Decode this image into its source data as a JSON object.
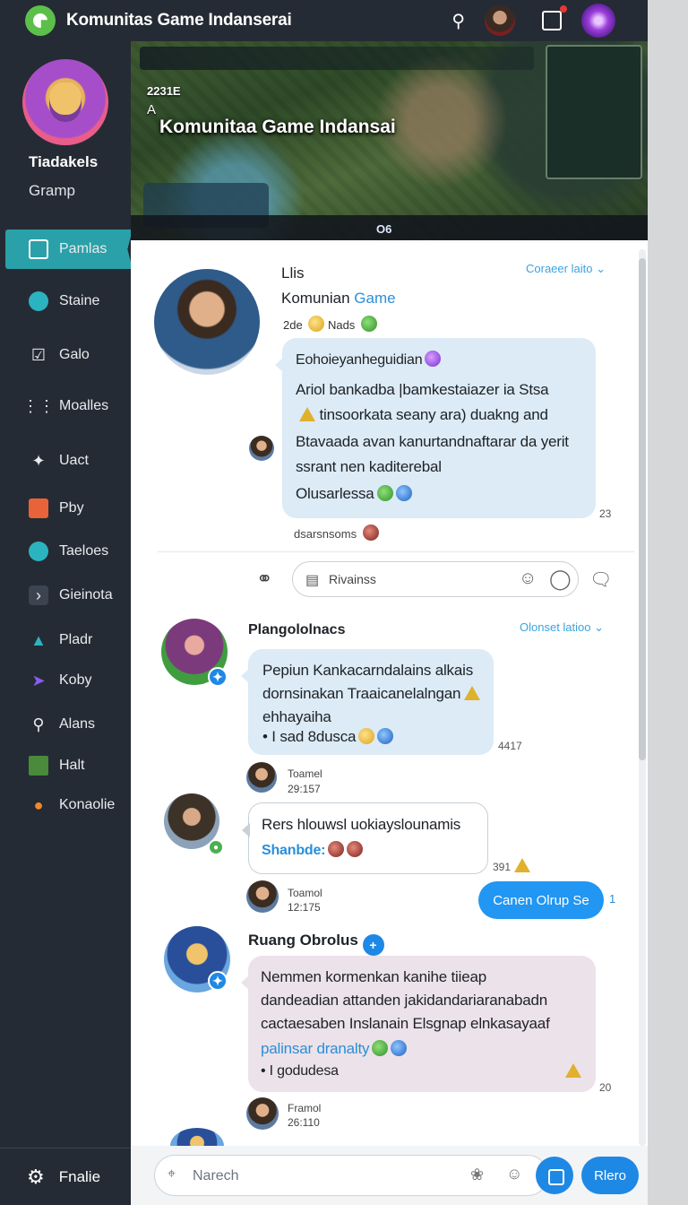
{
  "app": {
    "title": "Komunitas Game Indanserai"
  },
  "sidebar": {
    "group_name": "Tiadakels",
    "group_sub": "Gramp",
    "items": [
      {
        "label": "Pamlas",
        "icon": "window-icon"
      },
      {
        "label": "Staine",
        "icon": "chat-icon"
      },
      {
        "label": "Galo",
        "icon": "check-icon"
      },
      {
        "label": "Moalles",
        "icon": "grid-icon"
      },
      {
        "label": "Uact",
        "icon": "pin-icon"
      },
      {
        "label": "Pby",
        "icon": "image-icon"
      },
      {
        "label": "Taeloes",
        "icon": "chat-icon"
      },
      {
        "label": "Gieinota",
        "icon": "share-icon"
      },
      {
        "label": "Pladr",
        "icon": "drop-icon"
      },
      {
        "label": "Koby",
        "icon": "rocket-icon"
      },
      {
        "label": "Alans",
        "icon": "search-icon"
      },
      {
        "label": "Halt",
        "icon": "chart-icon"
      },
      {
        "label": "Konaolie",
        "icon": "flame-icon"
      }
    ],
    "settings_label": "Fnalie"
  },
  "banner": {
    "title": "Komunitaa Game Indansai",
    "level": "2231E",
    "letter": "A",
    "code": "O6"
  },
  "post1": {
    "author_line1": "Llis",
    "author_line2": "Komunian",
    "author_tag": "Game",
    "meta": "2de",
    "meta2": "Nads",
    "link": "Coraeer laito",
    "bubble_title": "Eohoieyanheguidian",
    "line1": "Ariol bankadba |bamkestaiazer ia Stsa",
    "line2": "tinsoorkata seany ara) duakng and",
    "line3": "Btavaada avan kanurtandnaftarar da yerit",
    "line4": "ssrant nen kaditerebal",
    "line5": "Olusarlessa",
    "count": "23",
    "footer": "dsarsnsoms",
    "reply_placeholder": "Rivainss"
  },
  "post2": {
    "author": "Plangololnacs",
    "link": "Olonset latioo",
    "line1": "Pepiun Kankacarndalains alkais",
    "line2": "dornsinakan Traaicanelalngan",
    "line3": "ehhayaiha",
    "line4": "• I sad 8dusca",
    "count": "4417",
    "sub_name": "Toamel",
    "sub_meta": "29:157"
  },
  "post3": {
    "line1": "Rers hlouwsl uokiayslounamis",
    "tag": "Shanbde:",
    "count": "391",
    "sub_name": "Toamol",
    "sub_meta": "12:175",
    "join_label": "Canen Olrup Se",
    "join_count": "1"
  },
  "post4": {
    "author": "Ruang Obrolus",
    "line1": "Nemmen kormenkan kanihe tiieap",
    "line2": "dandeadian attanden jakidandariaranabadn",
    "line3": "cactaesaben Inslanain Elsgnap elnkasayaaf",
    "link_line": "palinsar dranalty",
    "line5": "• I godudesa",
    "count": "20",
    "sub_name": "Framol",
    "sub_meta": "26:110"
  },
  "composer": {
    "placeholder": "Narech",
    "button": "Rlero"
  }
}
